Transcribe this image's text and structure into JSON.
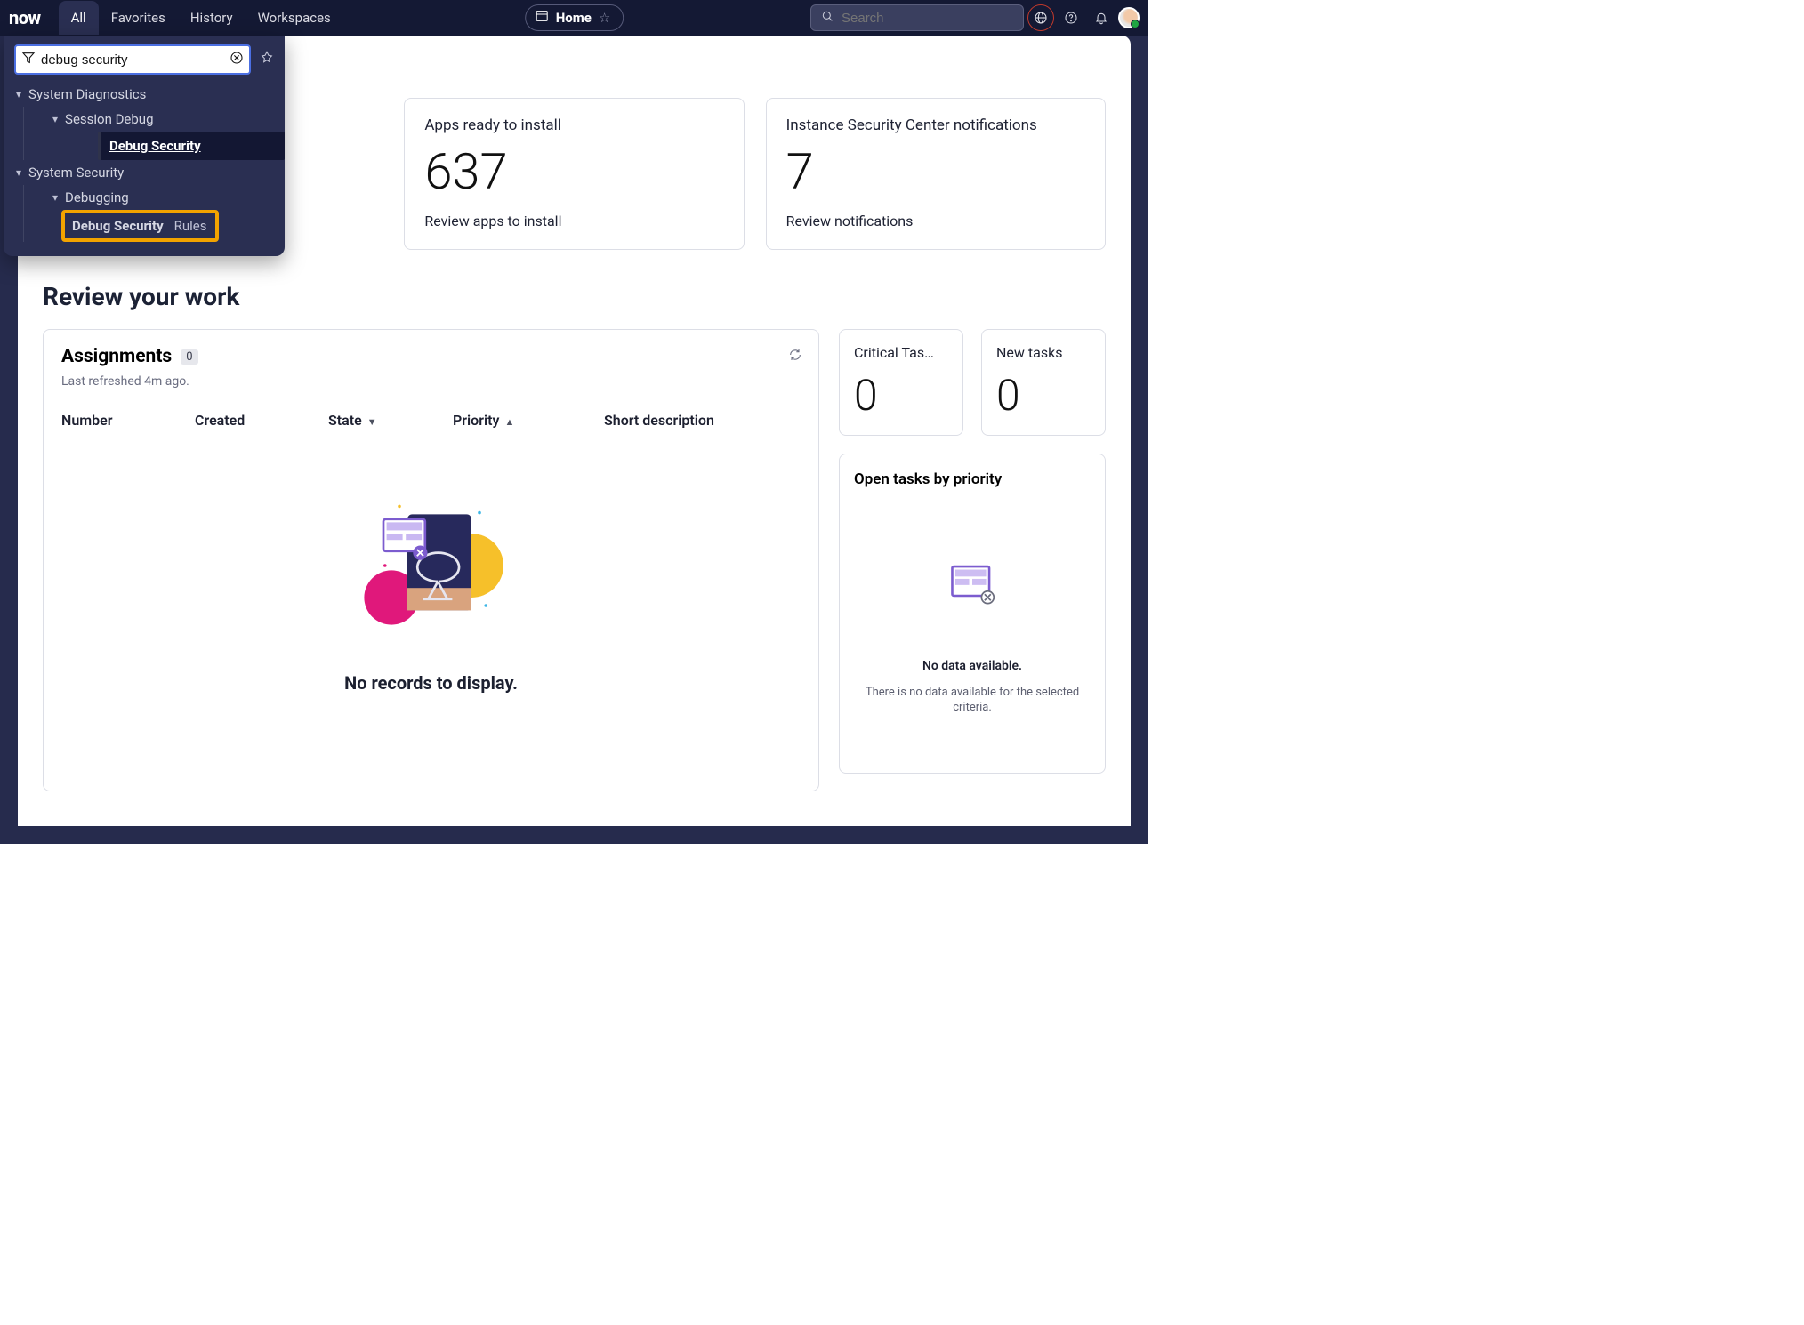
{
  "nav": {
    "logo": "now",
    "tabs": [
      "All",
      "Favorites",
      "History",
      "Workspaces"
    ],
    "active_tab": "All",
    "home_label": "Home",
    "search_placeholder": "Search"
  },
  "nav_dropdown": {
    "filter_value": "debug security",
    "groups": [
      {
        "label": "System Diagnostics",
        "children": [
          {
            "label": "Session Debug",
            "children": [
              {
                "label": "Debug Security",
                "selected": true
              }
            ]
          }
        ]
      },
      {
        "label": "System Security",
        "children": [
          {
            "label": "Debugging",
            "children": [
              {
                "label_bold": "Debug Security",
                "label_rest": "Rules",
                "highlighted": true
              }
            ]
          }
        ]
      }
    ]
  },
  "cards": {
    "apps_ready": {
      "title": "Apps ready to install",
      "value": "637",
      "link": "Review apps to install"
    },
    "isc_notifs": {
      "title": "Instance Security Center notifications",
      "value": "7",
      "link": "Review notifications"
    }
  },
  "section_title": "Review your work",
  "assignments": {
    "title": "Assignments",
    "count": "0",
    "refreshed": "Last refreshed 4m ago.",
    "columns": [
      "Number",
      "Created",
      "State",
      "Priority",
      "Short description"
    ],
    "sort_state": "desc",
    "sort_priority": "asc",
    "empty_msg": "No records to display."
  },
  "side": {
    "critical": {
      "title": "Critical Tas…",
      "value": "0"
    },
    "new_tasks": {
      "title": "New tasks",
      "value": "0"
    },
    "priority_title": "Open tasks by priority",
    "no_data_title": "No data available.",
    "no_data_sub": "There is no data available for the selected criteria."
  }
}
